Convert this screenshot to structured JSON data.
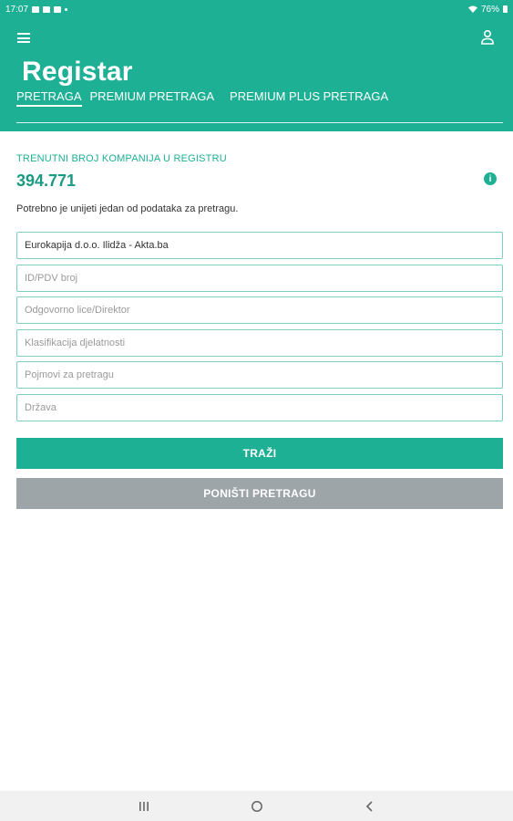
{
  "status_bar": {
    "time": "17:07",
    "battery": "76%"
  },
  "app_bar": {
    "title": "Registar"
  },
  "tabs": [
    {
      "label": "PRETRAGA"
    },
    {
      "label": "PREMIUM PRETRAGA"
    },
    {
      "label": "PREMIUM PLUS PRETRAGA"
    }
  ],
  "registry": {
    "count_label": "TRENUTNI BROJ KOMPANIJA U REGISTRU",
    "count_value": "394.771"
  },
  "hint": "Potrebno je unijeti jedan od podataka za pretragu.",
  "fields": [
    {
      "value": "Eurokapija d.o.o. Ilidža - Akta.ba",
      "placeholder": ""
    },
    {
      "value": "",
      "placeholder": "ID/PDV broj"
    },
    {
      "value": "",
      "placeholder": "Odgovorno lice/Direktor"
    },
    {
      "value": "",
      "placeholder": "Klasifikacija djelatnosti"
    },
    {
      "value": "",
      "placeholder": "Pojmovi za pretragu"
    },
    {
      "value": "",
      "placeholder": "Država"
    }
  ],
  "buttons": {
    "search": "TRAŽI",
    "reset": "PONIŠTI PRETRAGU"
  },
  "colors": {
    "primary": "#1eb094",
    "secondary_button": "#9ea5a8",
    "field_border": "#7fcfbf"
  }
}
